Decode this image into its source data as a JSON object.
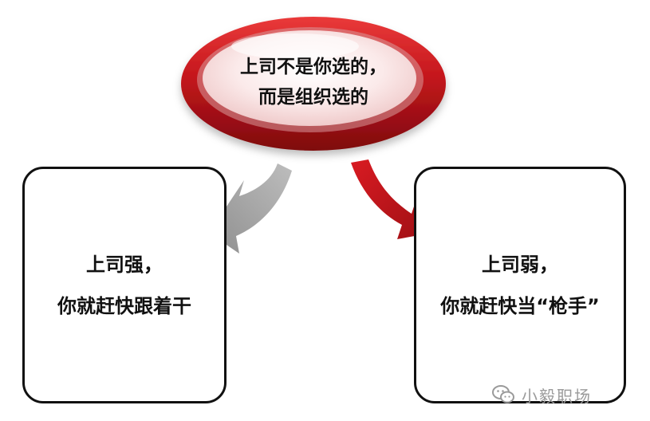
{
  "title": {
    "line1": "上司不是你选的，",
    "line2": "而是组织选的"
  },
  "left_box": {
    "line1": "上司强，",
    "line2": "你就赶快跟着干"
  },
  "right_box": {
    "line1": "上司弱，",
    "line2": "你就赶快当“枪手”"
  },
  "watermark": {
    "text": "小毅职场",
    "icon": "wechat-icon"
  },
  "colors": {
    "red": "#c4161c",
    "gray": "#a3a3a3",
    "pink_light": "#f9e4e4"
  }
}
